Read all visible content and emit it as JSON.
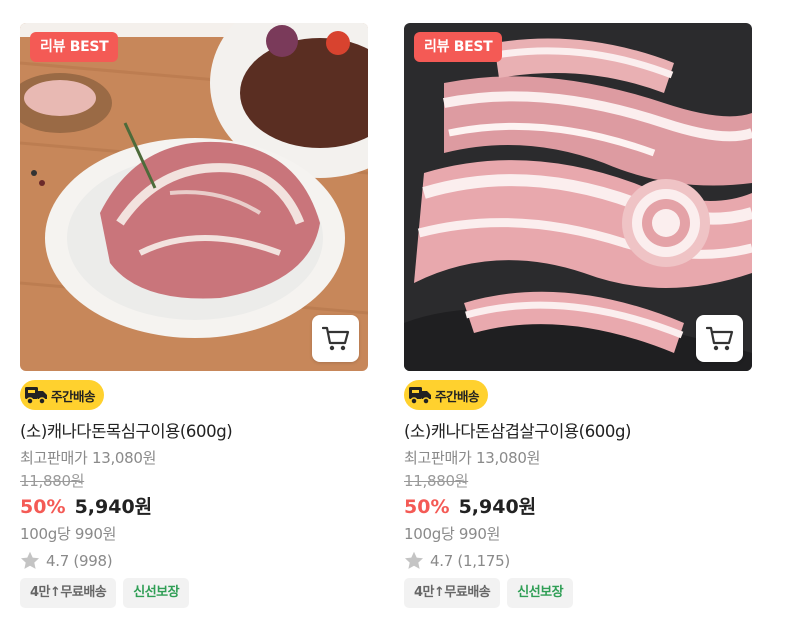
{
  "products": [
    {
      "badge": "리뷰 BEST",
      "delivery_label": "주간배송",
      "name": "(소)캐나다돈목심구이용(600g)",
      "best_price": "최고판매가 13,080원",
      "original_price": "11,880원",
      "discount": "50%",
      "sale_price": "5,940원",
      "unit_price": "100g당 990원",
      "rating": "4.7 (998)",
      "tags": [
        "4만↑무료배송",
        "신선보장"
      ]
    },
    {
      "badge": "리뷰 BEST",
      "delivery_label": "주간배송",
      "name": "(소)캐나다돈삼겹살구이용(600g)",
      "best_price": "최고판매가 13,080원",
      "original_price": "11,880원",
      "discount": "50%",
      "sale_price": "5,940원",
      "unit_price": "100g당 990원",
      "rating": "4.7 (1,175)",
      "tags": [
        "4만↑무료배송",
        "신선보장"
      ]
    }
  ],
  "colors": {
    "badge_bg": "#f45a55",
    "delivery_bg": "#ffd12e",
    "discount": "#f45a55",
    "fresh_tag": "#2f9e55",
    "star": "#c4c4c4"
  },
  "icons": {
    "cart": "cart-icon",
    "delivery": "truck-icon",
    "rating": "star-icon"
  }
}
